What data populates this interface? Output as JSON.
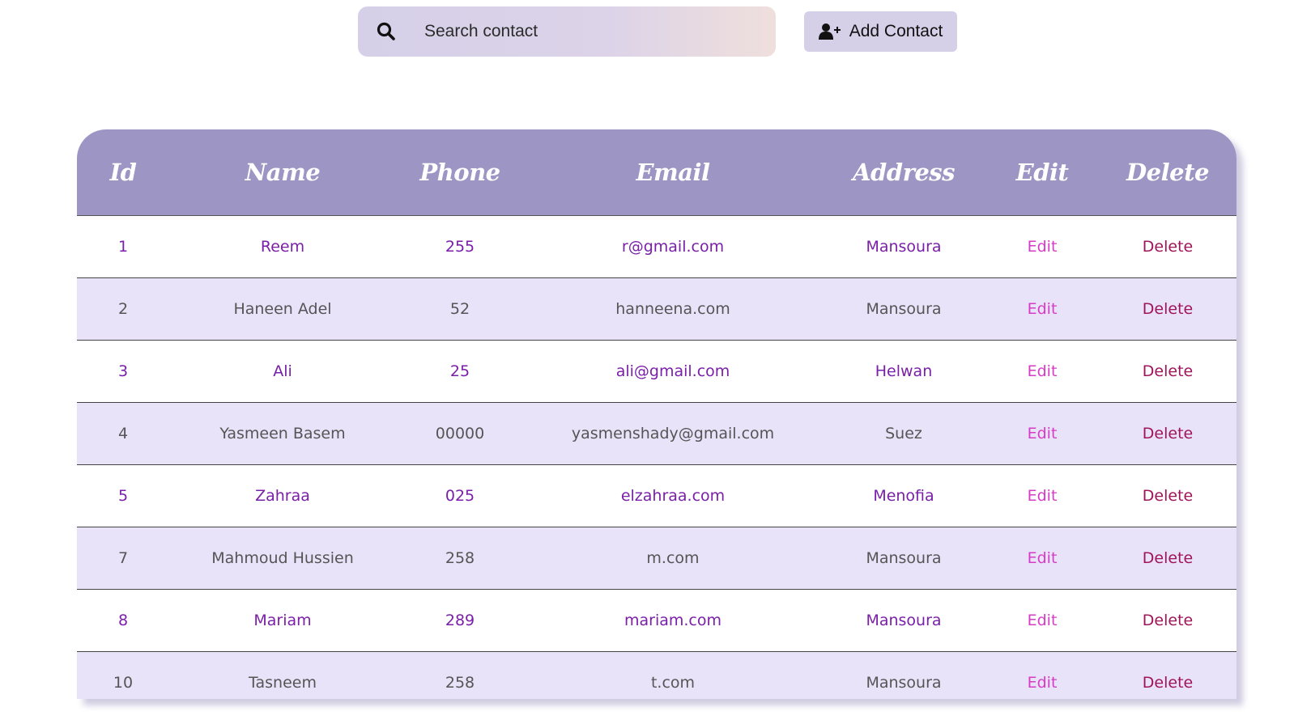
{
  "search": {
    "placeholder": "Search contact",
    "value": ""
  },
  "toolbar": {
    "add_label": "Add Contact"
  },
  "table": {
    "headers": [
      "Id",
      "Name",
      "Phone",
      "Email",
      "Address",
      "Edit",
      "Delete"
    ],
    "rows": [
      {
        "id": "1",
        "name": "Reem",
        "phone": "255",
        "email": "r@gmail.com",
        "address": "Mansoura",
        "edit": "Edit",
        "delete": "Delete"
      },
      {
        "id": "2",
        "name": "Haneen Adel",
        "phone": "52",
        "email": "hanneena.com",
        "address": "Mansoura",
        "edit": "Edit",
        "delete": "Delete"
      },
      {
        "id": "3",
        "name": "Ali",
        "phone": "25",
        "email": "ali@gmail.com",
        "address": "Helwan",
        "edit": "Edit",
        "delete": "Delete"
      },
      {
        "id": "4",
        "name": "Yasmeen Basem",
        "phone": "00000",
        "email": "yasmenshady@gmail.com",
        "address": "Suez",
        "edit": "Edit",
        "delete": "Delete"
      },
      {
        "id": "5",
        "name": "Zahraa",
        "phone": "025",
        "email": "elzahraa.com",
        "address": "Menofia",
        "edit": "Edit",
        "delete": "Delete"
      },
      {
        "id": "7",
        "name": "Mahmoud Hussien",
        "phone": "258",
        "email": "m.com",
        "address": "Mansoura",
        "edit": "Edit",
        "delete": "Delete"
      },
      {
        "id": "8",
        "name": "Mariam",
        "phone": "289",
        "email": "mariam.com",
        "address": "Mansoura",
        "edit": "Edit",
        "delete": "Delete"
      },
      {
        "id": "10",
        "name": "Tasneem",
        "phone": "258",
        "email": "t.com",
        "address": "Mansoura",
        "edit": "Edit",
        "delete": "Delete"
      }
    ]
  },
  "icons": {
    "search": "search-icon",
    "add_user": "add-user-icon"
  },
  "colors": {
    "header_bg": "#9d96c4",
    "row_alt_bg": "#e9e3fa",
    "odd_text": "#7a1fa8",
    "edit_text": "#d63cc5",
    "delete_text": "#a0145a",
    "button_bg": "#d5cfe8"
  }
}
